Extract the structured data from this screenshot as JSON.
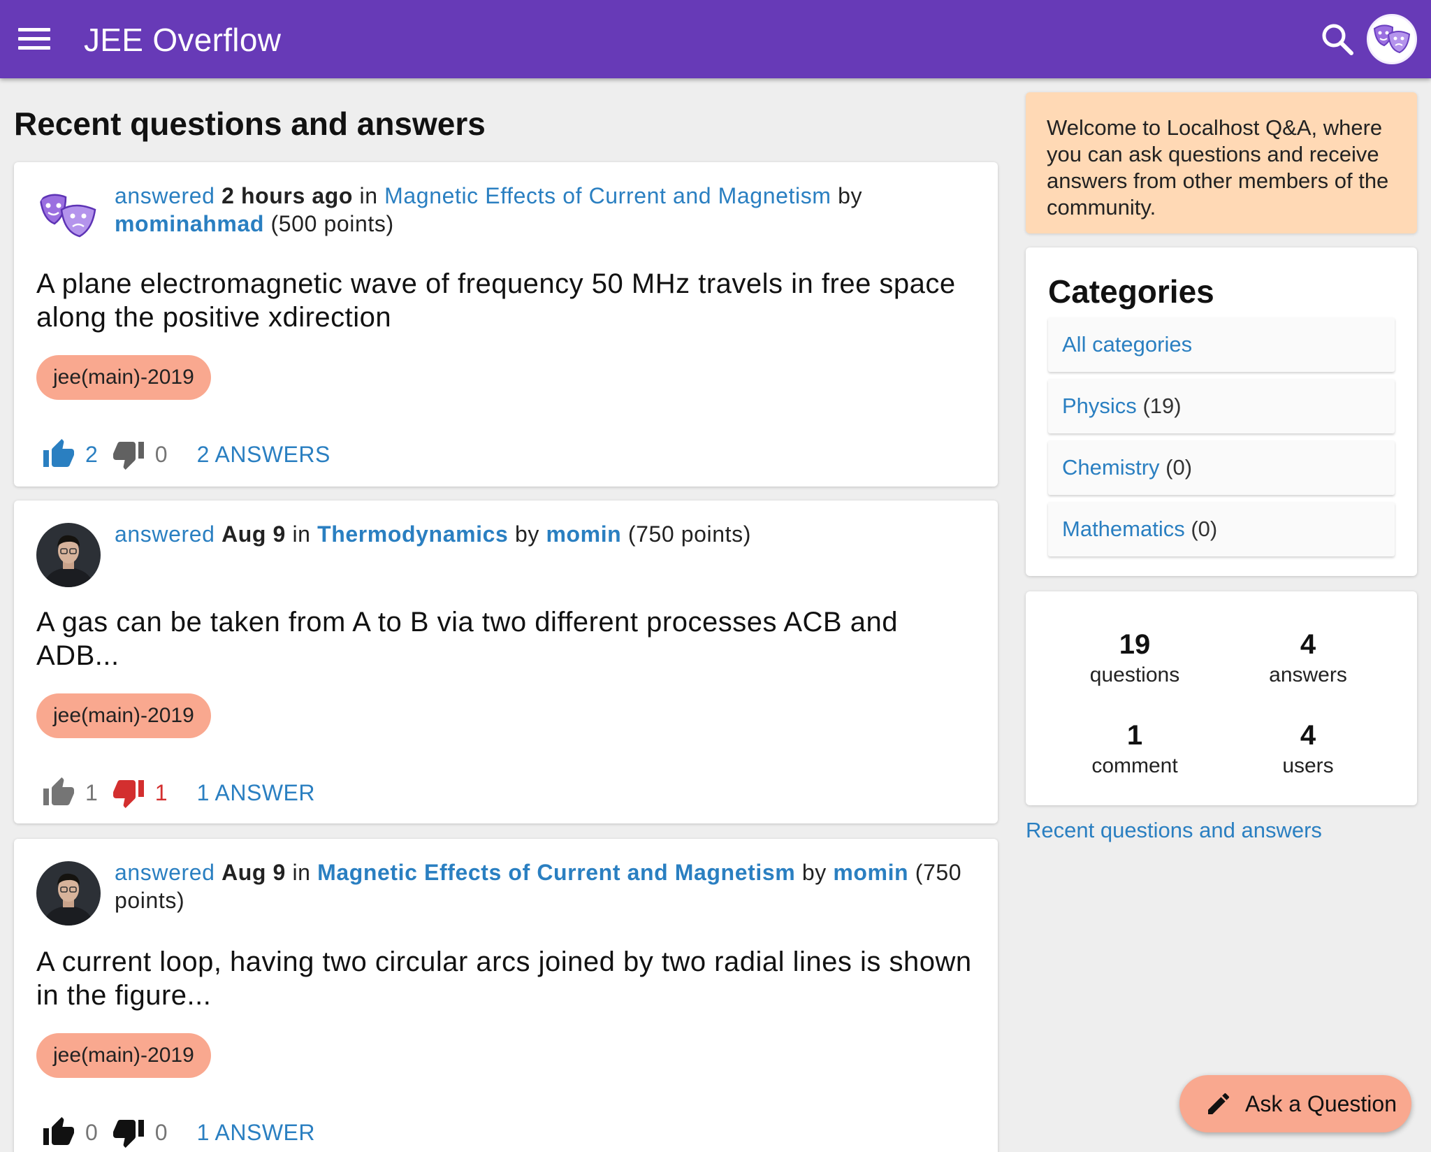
{
  "app": {
    "title": "JEE Overflow"
  },
  "page": {
    "heading": "Recent questions and answers"
  },
  "colors": {
    "appbar": "#673ab7",
    "link": "#2a7fc1",
    "tag": "#f9a88f",
    "welcome": "#ffd9b5",
    "downvote_active": "#d32f2f"
  },
  "icons": {
    "menu": "hamburger-icon",
    "search": "search-icon",
    "avatar": "theater-masks-icon",
    "upvote": "thumbs-up-icon",
    "downvote": "thumbs-down-icon",
    "fab": "pencil-icon"
  },
  "questions": [
    {
      "action": "answered",
      "when": "2 hours ago",
      "in_word": "in",
      "category": "Magnetic Effects of Current and Magnetism",
      "by_word": "by",
      "user": "mominahmad",
      "points": "(500 points)",
      "title": "A plane electromagnetic wave of frequency 50 MHz travels in free space along the positive xdirection",
      "tag": "jee(main)-2019",
      "upvotes": "2",
      "downvotes": "0",
      "answers": "2 ANSWERS"
    },
    {
      "action": "answered",
      "when": "Aug 9",
      "in_word": "in",
      "category": "Thermodynamics",
      "by_word": "by",
      "user": "momin",
      "points": "(750 points)",
      "title": "A gas can be taken from A to B via two different processes ACB and ADB...",
      "tag": "jee(main)-2019",
      "upvotes": "1",
      "downvotes": "1",
      "answers": "1 ANSWER"
    },
    {
      "action": "answered",
      "when": "Aug 9",
      "in_word": "in",
      "category": "Magnetic Effects of Current and Magnetism",
      "by_word": "by",
      "user": "momin",
      "points": "(750 points)",
      "title": "A current loop, having two circular arcs joined by two radial lines is shown in the figure...",
      "tag": "jee(main)-2019",
      "upvotes": "0",
      "downvotes": "0",
      "answers": "1 ANSWER"
    }
  ],
  "sidebar": {
    "welcome": "Welcome to Localhost Q&A, where you can ask questions and receive answers from other members of the community.",
    "categories_heading": "Categories",
    "categories": [
      {
        "name": "All categories",
        "count": ""
      },
      {
        "name": "Physics",
        "count": "(19)"
      },
      {
        "name": "Chemistry",
        "count": "(0)"
      },
      {
        "name": "Mathematics",
        "count": "(0)"
      }
    ],
    "stats": [
      {
        "num": "19",
        "label": "questions"
      },
      {
        "num": "4",
        "label": "answers"
      },
      {
        "num": "1",
        "label": "comment"
      },
      {
        "num": "4",
        "label": "users"
      }
    ],
    "recent_link": "Recent questions and answers"
  },
  "fab": {
    "label": "Ask a Question"
  }
}
